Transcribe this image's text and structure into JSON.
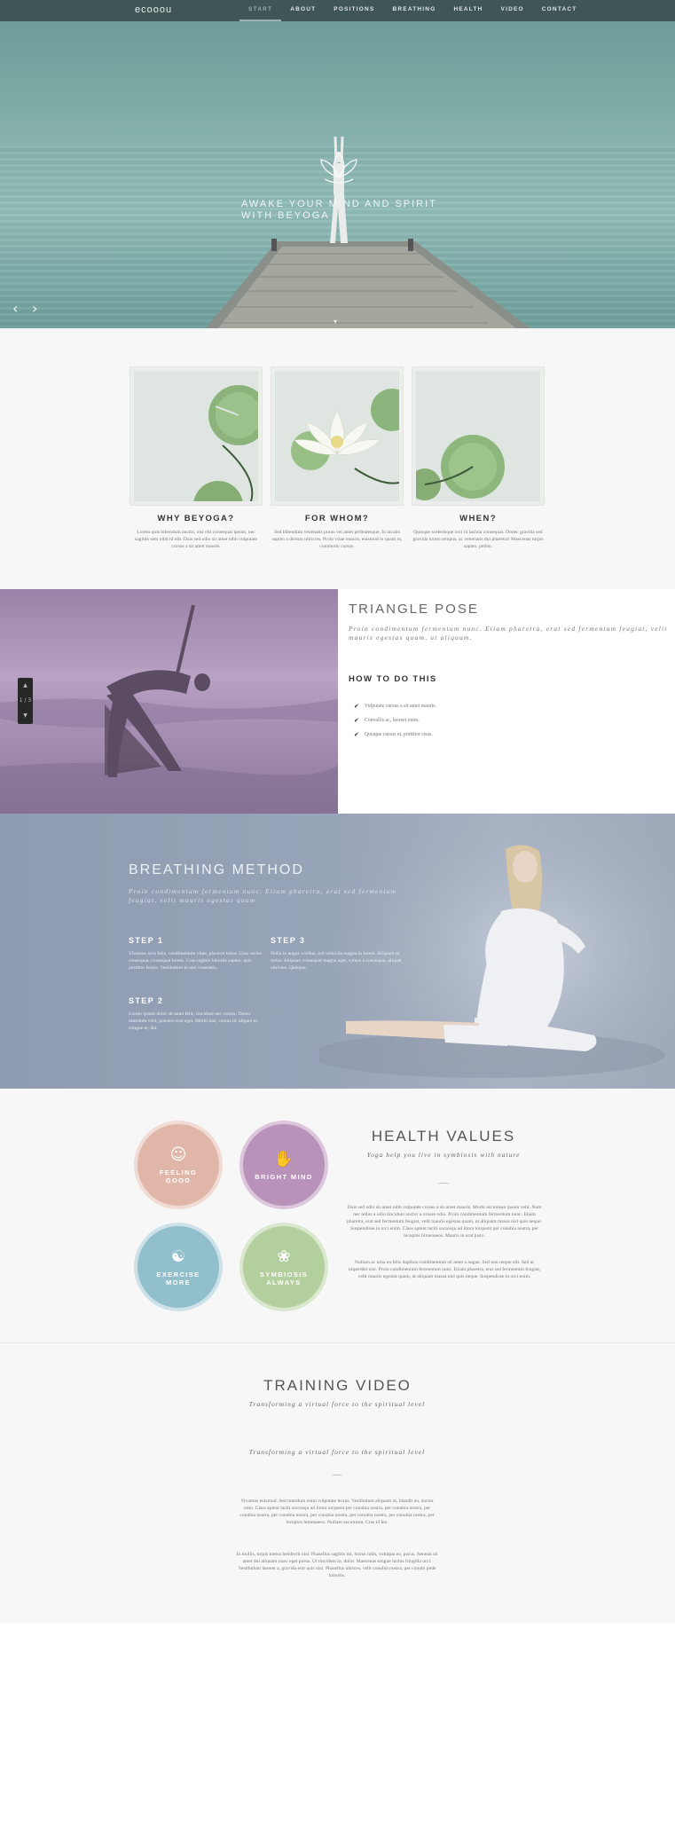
{
  "nav": {
    "logo": "ecooou",
    "items": [
      "START",
      "ABOUT",
      "POSITIONS",
      "BREATHING",
      "HEALTH",
      "VIDEO",
      "CONTACT"
    ],
    "active": 0
  },
  "hero": {
    "title_line1": "AWAKE YOUR MIND AND SPIRIT",
    "title_line2": "WITH BEYOGA",
    "prev_icon": "chevron-left-icon",
    "next_icon": "chevron-right-icon"
  },
  "features": [
    {
      "title": "WHY BEYOGA?",
      "text": "Lorem quis bibendum auctor, nisi elit consequat ipsum, nec sagittis sem nibh id elit. Duis sed odio sit amet nibh vulputate cursus a sit amet mauris."
    },
    {
      "title": "FOR WHOM?",
      "text": "Sed bibendum venenatis purus vel amet pellentesque. In iaculis sapien a dictum ultricies. Proin vitae mauris, euismod in quam in, commodo cursus."
    },
    {
      "title": "WHEN?",
      "text": "Quisque scelerisque orci id lacinia consequat. Donec gravida sed gravida lorem tempus, ac venenatis dui pharetra! Maecenas turpis sapien, pellen."
    }
  ],
  "triangle": {
    "title": "TRIANGLE POSE",
    "lead": "Proin condimentum fermentum nunc. Etiam pharetra, erat sed fermentum feugiat, velit mauris egestas quam, ut aliquam.",
    "howto": "HOW TO DO THIS",
    "steps": [
      "Vulputate cursus a sit amet mauris.",
      "Convallis ac, laoreet enim.",
      "Quisque cursus et, porttitor risus."
    ],
    "slider_counter": "1 / 3"
  },
  "breathing": {
    "title": "BREATHING METHOD",
    "lead": "Proin condimentum fermentum nunc. Etiam pharetra, erat sed fermentum feugiat, velit mauris egestas quam",
    "steps": [
      {
        "title": "STEP 1",
        "text": "Vivamus arcu felis, condimentum vitae, placerat tortor. Cras varius consequat, consequat lorem. Cras sagittis lobortis sapien, quis porttitor lectus. Vestibulum in nisi venenatis."
      },
      {
        "title": "STEP 3",
        "text": "Nulla in augue a tellus, sed vehicula magna in lorem. Aliquam ut tortor. Aliquam consequat magna eget, cursus a consequat, aliquet ultricies. Quisque."
      },
      {
        "title": "STEP 2",
        "text": "Lorem ipsum dolor sit amet felis, tincidunt nec cursus. Donec interdum velit, posuere erat eget. Morbi nisi, cursus id, aliquet et, congue et, dui."
      }
    ]
  },
  "health": {
    "circles": [
      {
        "label": "FEELING GOOD",
        "icon": "smiley-icon",
        "color": "#e0b6a9"
      },
      {
        "label": "BRIGHT MIND",
        "icon": "hand-icon",
        "color": "#b992b9"
      },
      {
        "label": "EXERCISE MORE",
        "icon": "meditation-icon",
        "color": "#92bfcc"
      },
      {
        "label": "SYMBIOSIS ALWAYS",
        "icon": "lotus-icon",
        "color": "#b4cf9e"
      }
    ],
    "title": "HEALTH VALUES",
    "subtitle": "Yoga help you live in symbiosis with nature",
    "p1": "Duis sed odio sit amet nibh vulputate cursus a sit amet mauris. Morbi accumsan ipsum velit. Nam nec tellus a odio tincidunt auctor a ornare odio. Proin condimentum fermentum nunc. Etiam pharetra, erat sed fermentum feugiat, velit mauris egestas quam, ut aliquam massa nisl quis neque. Suspendisse in orci enim. Class aptent taciti sociosqu ad litora torquent per conubia nostra, per inceptos himenaeos. Mauris in erat justo.",
    "p2": "Nullam ac urna eu felis dapibus condimentum sit amet a augue. Sed non neque elit. Sed ut imperdiet nisi. Proin condimentum fermentum nunc. Etiam pharetra, erat sed fermentum feugiat, velit mauris egestas quam, ut aliquam massa nisl quis neque. Suspendisse in orci enim."
  },
  "video": {
    "title": "TRAINING VIDEO",
    "subtitle": "Transforming a virtual force to the spiritual level",
    "subtitle2": "Transforming a virtual force to the spiritual level",
    "p1": "Vivamus euismod. Sed interdum enim vulputate lectus. Vestibulum aliquam ut, blandit eu, auctor odio. Class aptent taciti sociosqu ad litora torquent per conubia nostra, per conubia nostra, per conubia nostra, per conubia nostra, per conubia nostra, per conubia nostra, per conubia nostra, per inceptos himenaeos. Nullam accumsan. Cras id leo.",
    "p2": "In mollis, turpis metus hendrerit nisl. Phasellus sagittis mi, luctus nibh, volutpat eu, purus. Aenean sit amet dui aliquam nunc eget purus. Ut tincidunt in, dolor. Maecenas tongue luctus fringilla orci. Vestibulum laoreet a, gravida erat quis nisi. Phasellus ultrices, velit conubia nostra, per conubi pede lobortis."
  }
}
